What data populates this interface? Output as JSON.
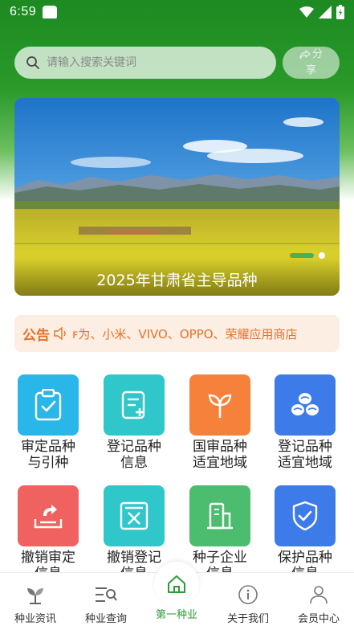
{
  "status_bar": {
    "time": "6:59"
  },
  "search": {
    "placeholder": "请输入搜索关键词"
  },
  "share": {
    "line1": "分",
    "line2": "享",
    "icon": "share-icon"
  },
  "banner": {
    "caption": "2025年甘肃省主导品种"
  },
  "notice": {
    "label": "公告",
    "text": "ꜰ为、小米、VIVO、OPPO、荣耀应用商店"
  },
  "grid": {
    "items": [
      {
        "line1": "审定品种",
        "line2": "与引种",
        "color": "#29b6e8",
        "icon": "clipboard-check-icon"
      },
      {
        "line1": "登记品种",
        "line2": "信息",
        "color": "#2fc7c9",
        "icon": "document-add-icon"
      },
      {
        "line1": "国审品种",
        "line2": "适宜地域",
        "color": "#f5813a",
        "icon": "sprout-icon"
      },
      {
        "line1": "登记品种",
        "line2": "适宜地域",
        "color": "#3d7be8",
        "icon": "seeds-icon"
      },
      {
        "line1": "撤销审定",
        "line2": "信息",
        "color": "#f0625f",
        "icon": "revoke-icon"
      },
      {
        "line1": "撤销登记",
        "line2": "信息",
        "color": "#2fc7c9",
        "icon": "cancel-box-icon"
      },
      {
        "line1": "种子企业",
        "line2": "信息",
        "color": "#4cbc6e",
        "icon": "building-icon"
      },
      {
        "line1": "保护品种",
        "line2": "信息",
        "color": "#3d7be8",
        "icon": "shield-check-icon"
      }
    ]
  },
  "nav": {
    "items": [
      {
        "label": "种业资讯",
        "icon": "sprout-nav-icon"
      },
      {
        "label": "种业查询",
        "icon": "list-search-icon"
      },
      {
        "label": "第一种业",
        "icon": "home-icon",
        "active": true
      },
      {
        "label": "关于我们",
        "icon": "info-icon"
      },
      {
        "label": "会员中心",
        "icon": "user-icon"
      }
    ],
    "active_color": "#2e9b3a"
  }
}
